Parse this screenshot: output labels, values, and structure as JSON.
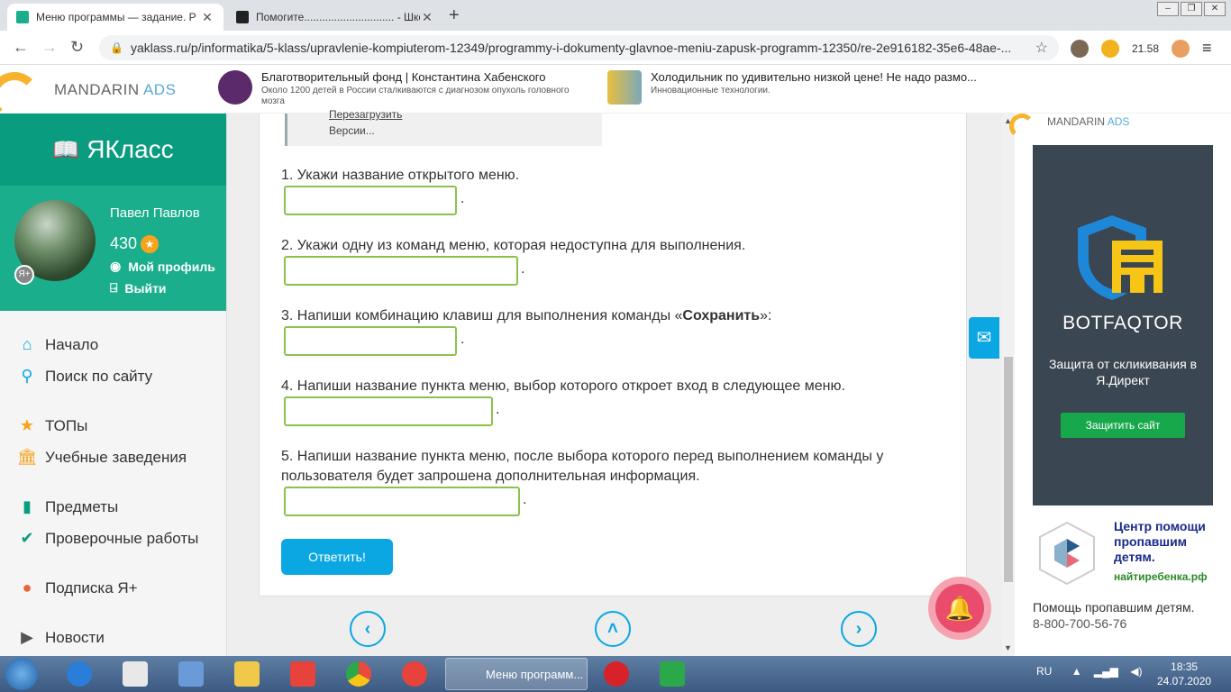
{
  "browser": {
    "tabs": [
      {
        "title": "Меню программы — задание. Р"
      },
      {
        "title": "Помогите.............................. - Школьн"
      }
    ],
    "new_tab_icon": "plus-icon",
    "address": {
      "url": "yaklass.ru/p/informatika/5-klass/upravlenie-kompiuterom-12349/programmy-i-dokumenty-glavnoe-meniu-zapusk-programm-12350/re-2e916182-35e6-48ae-..."
    },
    "toolbar_value": "21.58"
  },
  "top_ads": {
    "logo_a": "MANDARIN",
    "logo_b": "ADS",
    "ad1": {
      "title": "Благотворительный фонд | Константина Хабенского",
      "text": "Около 1200 детей в России сталкиваются с диагнозом опухоль головного мозга"
    },
    "ad2": {
      "title": "Холодильник по удивительно низкой цене! Не надо размо...",
      "text": "Инновационные технологии."
    }
  },
  "sidebar": {
    "brand": "ЯКласс",
    "user": {
      "name": "Павел Павлов",
      "points": "430",
      "profile_link": "Мой профиль",
      "logout_link": "Выйти"
    },
    "items": [
      {
        "label": "Начало",
        "icon": "home-icon"
      },
      {
        "label": "Поиск по сайту",
        "icon": "search-icon"
      },
      {
        "label": "ТОПы",
        "icon": "star-icon"
      },
      {
        "label": "Учебные заведения",
        "icon": "school-icon"
      },
      {
        "label": "Предметы",
        "icon": "book-icon"
      },
      {
        "label": "Проверочные работы",
        "icon": "check-icon"
      },
      {
        "label": "Подписка Я+",
        "icon": "subscription-icon"
      },
      {
        "label": "Новости",
        "icon": "news-icon"
      }
    ]
  },
  "task": {
    "context_menu": [
      "Перезагрузить",
      "Версии..."
    ],
    "questions": [
      {
        "text": "1. Укажи название открытого меню.",
        "value": ""
      },
      {
        "text": "2. Укажи одну из команд меню, которая недоступна для выполнения.",
        "value": ""
      },
      {
        "text_before": "3. Напиши комбинацию клавиш для выполнения команды «",
        "text_bold": "Сохранить",
        "text_after": "»:",
        "value": ""
      },
      {
        "text": "4. Напиши название пункта меню, выбор которого откроет вход в следующее меню.",
        "value": ""
      },
      {
        "text": "5. Напиши название пункта меню, после выбора которого перед выполнением команды у пользователя будет запрошена дополнительная информация.",
        "value": ""
      }
    ],
    "period": ".",
    "submit_label": "Ответить!",
    "pager": {
      "prev": "‹",
      "up": "˄",
      "next": "›"
    }
  },
  "right_ad": {
    "logo_a": "MANDARIN",
    "logo_b": "ADS",
    "brand": "BOTFAQTOR",
    "subtitle": "Защита от скликивания в Я.Директ",
    "button": "Защитить сайт",
    "cpp_title": "Центр помощи пропавшим детям.",
    "cpp_link": "найтиребенка.рф",
    "cpp_desc": "Помощь пропавшим детям.",
    "cpp_phone": "8-800-700-56-76"
  },
  "taskbar": {
    "active_window": "Меню программ...",
    "lang": "RU",
    "time": "18:35",
    "date": "24.07.2020"
  },
  "colors": {
    "brand_green": "#0a9c7f",
    "accent_blue": "#0ba7e3",
    "input_border": "#8bc34a",
    "bell_red": "#e94c6c"
  }
}
